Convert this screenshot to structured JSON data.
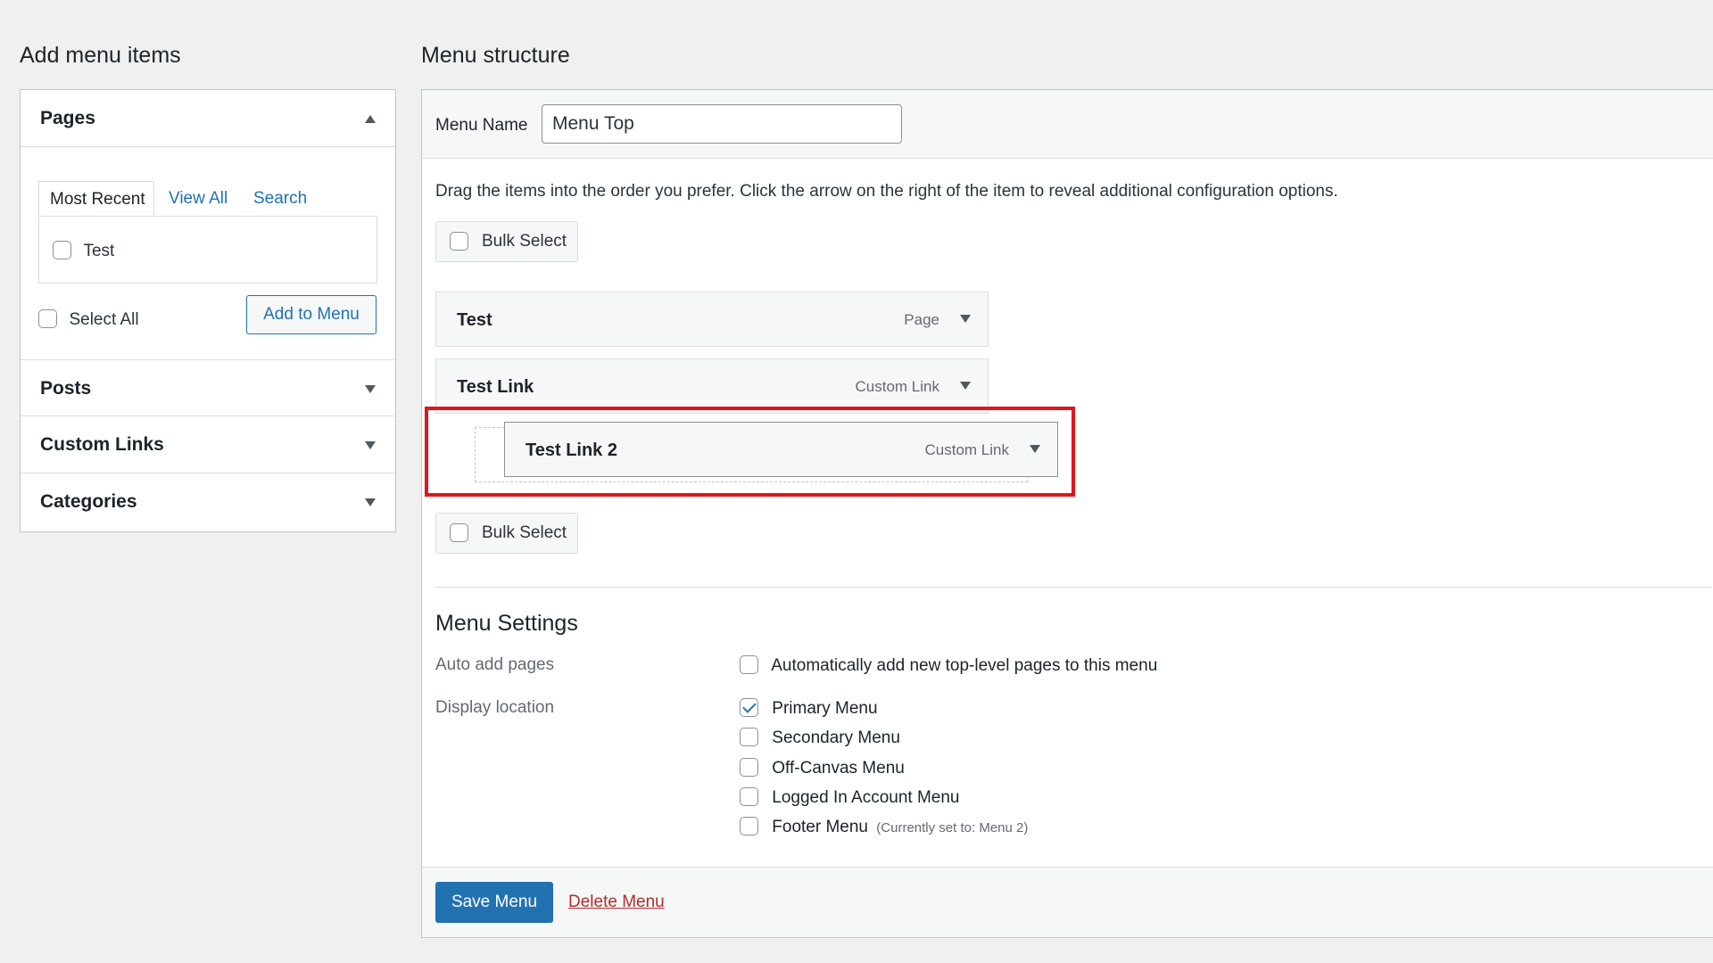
{
  "left": {
    "heading": "Add menu items",
    "pages_label": "Pages",
    "tabs": [
      "Most Recent",
      "View All",
      "Search"
    ],
    "page_items": [
      "Test"
    ],
    "select_all": "Select All",
    "add_button": "Add to Menu",
    "posts_label": "Posts",
    "custom_links_label": "Custom Links",
    "categories_label": "Categories"
  },
  "right": {
    "heading": "Menu structure",
    "menu_name_label": "Menu Name",
    "menu_name_value": "Menu Top",
    "instructions": "Drag the items into the order you prefer. Click the arrow on the right of the item to reveal additional configuration options.",
    "bulk_select": "Bulk Select",
    "items": [
      {
        "title": "Test",
        "type": "Page"
      },
      {
        "title": "Test Link",
        "type": "Custom Link"
      },
      {
        "title": "Test Link 2",
        "type": "Custom Link"
      }
    ],
    "settings_heading": "Menu Settings",
    "auto_add_label": "Auto add pages",
    "auto_add_text": "Automatically add new top-level pages to this menu",
    "display_location_label": "Display location",
    "locations": [
      {
        "label": "Primary Menu",
        "checked": true,
        "note": ""
      },
      {
        "label": "Secondary Menu",
        "checked": false,
        "note": ""
      },
      {
        "label": "Off-Canvas Menu",
        "checked": false,
        "note": ""
      },
      {
        "label": "Logged In Account Menu",
        "checked": false,
        "note": ""
      },
      {
        "label": "Footer Menu",
        "checked": false,
        "note": "(Currently set to: Menu 2)"
      }
    ],
    "save_button": "Save Menu",
    "delete_link": "Delete Menu"
  },
  "colors": {
    "primary": "#2271b1",
    "delete": "#b32d2e",
    "highlight": "#e0161d",
    "background": "#f0f0f1"
  }
}
